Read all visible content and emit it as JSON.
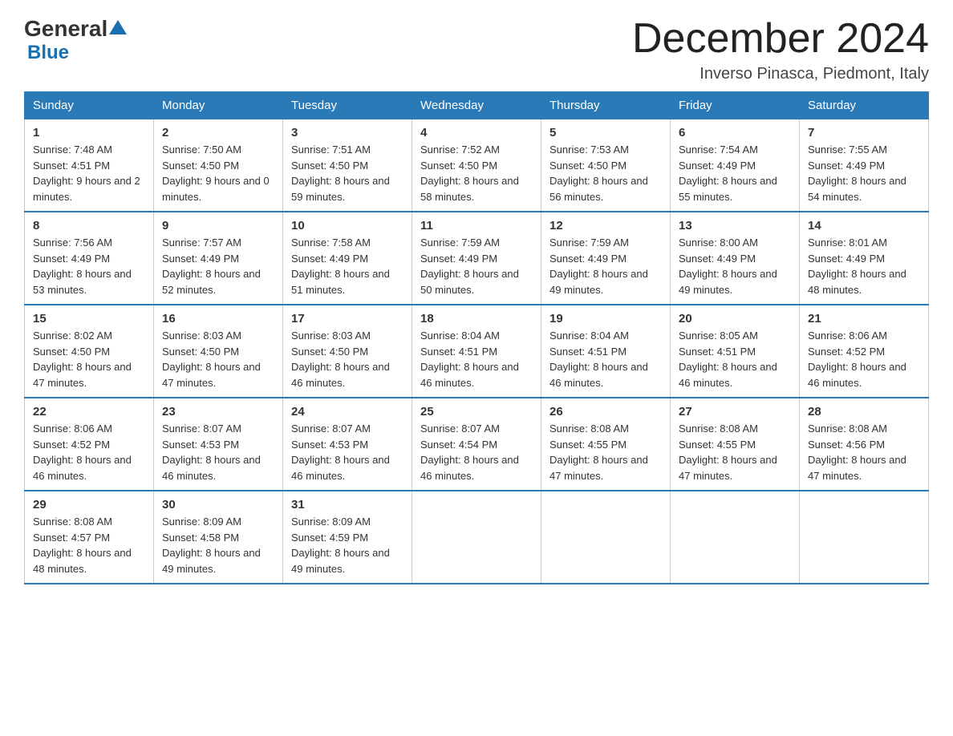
{
  "logo": {
    "general": "General",
    "arrow": "▲",
    "blue": "Blue"
  },
  "header": {
    "title": "December 2024",
    "location": "Inverso Pinasca, Piedmont, Italy"
  },
  "days_of_week": [
    "Sunday",
    "Monday",
    "Tuesday",
    "Wednesday",
    "Thursday",
    "Friday",
    "Saturday"
  ],
  "weeks": [
    [
      {
        "day": "1",
        "sunrise": "7:48 AM",
        "sunset": "4:51 PM",
        "daylight": "9 hours and 2 minutes."
      },
      {
        "day": "2",
        "sunrise": "7:50 AM",
        "sunset": "4:50 PM",
        "daylight": "9 hours and 0 minutes."
      },
      {
        "day": "3",
        "sunrise": "7:51 AM",
        "sunset": "4:50 PM",
        "daylight": "8 hours and 59 minutes."
      },
      {
        "day": "4",
        "sunrise": "7:52 AM",
        "sunset": "4:50 PM",
        "daylight": "8 hours and 58 minutes."
      },
      {
        "day": "5",
        "sunrise": "7:53 AM",
        "sunset": "4:50 PM",
        "daylight": "8 hours and 56 minutes."
      },
      {
        "day": "6",
        "sunrise": "7:54 AM",
        "sunset": "4:49 PM",
        "daylight": "8 hours and 55 minutes."
      },
      {
        "day": "7",
        "sunrise": "7:55 AM",
        "sunset": "4:49 PM",
        "daylight": "8 hours and 54 minutes."
      }
    ],
    [
      {
        "day": "8",
        "sunrise": "7:56 AM",
        "sunset": "4:49 PM",
        "daylight": "8 hours and 53 minutes."
      },
      {
        "day": "9",
        "sunrise": "7:57 AM",
        "sunset": "4:49 PM",
        "daylight": "8 hours and 52 minutes."
      },
      {
        "day": "10",
        "sunrise": "7:58 AM",
        "sunset": "4:49 PM",
        "daylight": "8 hours and 51 minutes."
      },
      {
        "day": "11",
        "sunrise": "7:59 AM",
        "sunset": "4:49 PM",
        "daylight": "8 hours and 50 minutes."
      },
      {
        "day": "12",
        "sunrise": "7:59 AM",
        "sunset": "4:49 PM",
        "daylight": "8 hours and 49 minutes."
      },
      {
        "day": "13",
        "sunrise": "8:00 AM",
        "sunset": "4:49 PM",
        "daylight": "8 hours and 49 minutes."
      },
      {
        "day": "14",
        "sunrise": "8:01 AM",
        "sunset": "4:49 PM",
        "daylight": "8 hours and 48 minutes."
      }
    ],
    [
      {
        "day": "15",
        "sunrise": "8:02 AM",
        "sunset": "4:50 PM",
        "daylight": "8 hours and 47 minutes."
      },
      {
        "day": "16",
        "sunrise": "8:03 AM",
        "sunset": "4:50 PM",
        "daylight": "8 hours and 47 minutes."
      },
      {
        "day": "17",
        "sunrise": "8:03 AM",
        "sunset": "4:50 PM",
        "daylight": "8 hours and 46 minutes."
      },
      {
        "day": "18",
        "sunrise": "8:04 AM",
        "sunset": "4:51 PM",
        "daylight": "8 hours and 46 minutes."
      },
      {
        "day": "19",
        "sunrise": "8:04 AM",
        "sunset": "4:51 PM",
        "daylight": "8 hours and 46 minutes."
      },
      {
        "day": "20",
        "sunrise": "8:05 AM",
        "sunset": "4:51 PM",
        "daylight": "8 hours and 46 minutes."
      },
      {
        "day": "21",
        "sunrise": "8:06 AM",
        "sunset": "4:52 PM",
        "daylight": "8 hours and 46 minutes."
      }
    ],
    [
      {
        "day": "22",
        "sunrise": "8:06 AM",
        "sunset": "4:52 PM",
        "daylight": "8 hours and 46 minutes."
      },
      {
        "day": "23",
        "sunrise": "8:07 AM",
        "sunset": "4:53 PM",
        "daylight": "8 hours and 46 minutes."
      },
      {
        "day": "24",
        "sunrise": "8:07 AM",
        "sunset": "4:53 PM",
        "daylight": "8 hours and 46 minutes."
      },
      {
        "day": "25",
        "sunrise": "8:07 AM",
        "sunset": "4:54 PM",
        "daylight": "8 hours and 46 minutes."
      },
      {
        "day": "26",
        "sunrise": "8:08 AM",
        "sunset": "4:55 PM",
        "daylight": "8 hours and 47 minutes."
      },
      {
        "day": "27",
        "sunrise": "8:08 AM",
        "sunset": "4:55 PM",
        "daylight": "8 hours and 47 minutes."
      },
      {
        "day": "28",
        "sunrise": "8:08 AM",
        "sunset": "4:56 PM",
        "daylight": "8 hours and 47 minutes."
      }
    ],
    [
      {
        "day": "29",
        "sunrise": "8:08 AM",
        "sunset": "4:57 PM",
        "daylight": "8 hours and 48 minutes."
      },
      {
        "day": "30",
        "sunrise": "8:09 AM",
        "sunset": "4:58 PM",
        "daylight": "8 hours and 49 minutes."
      },
      {
        "day": "31",
        "sunrise": "8:09 AM",
        "sunset": "4:59 PM",
        "daylight": "8 hours and 49 minutes."
      },
      null,
      null,
      null,
      null
    ]
  ],
  "labels": {
    "sunrise": "Sunrise:",
    "sunset": "Sunset:",
    "daylight": "Daylight:"
  }
}
